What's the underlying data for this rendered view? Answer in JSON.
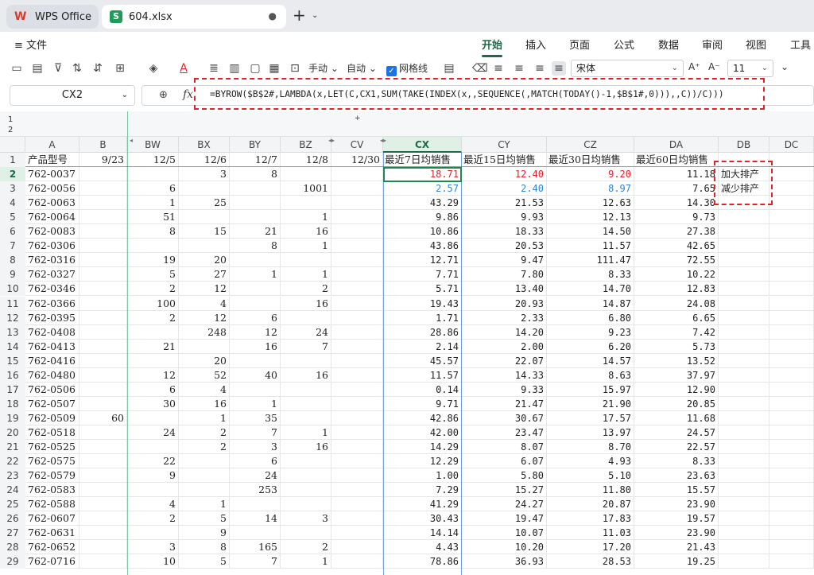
{
  "tabs": {
    "home_label": "WPS Office",
    "home_logo": "W",
    "file_label": "604.xlsx",
    "file_logo": "S",
    "dot": "●",
    "new_tab": "+",
    "menu": "⌄"
  },
  "menu": {
    "file_label": "≡ 文件",
    "items": [
      "开始",
      "插入",
      "页面",
      "公式",
      "数据",
      "审阅",
      "视图",
      "工具"
    ]
  },
  "toolbar": {
    "manual_label": "手动",
    "auto_label": "自动",
    "gridlines_label": "网格线",
    "font_name": "宋体",
    "font_size": "11",
    "font_grow": "A⁺",
    "font_shrink": "A⁻",
    "more": "⌄"
  },
  "formula_bar": {
    "cell_ref": "CX2",
    "formula": "=BYROW($B$2#,LAMBDA(x,LET(C,CX1,SUM(TAKE(INDEX(x,,SEQUENCE(,MATCH(TODAY()-1,$B$1#,0))),,C))/C)))"
  },
  "outline": {
    "levels": [
      "1",
      "2"
    ],
    "plus": "+"
  },
  "columns": [
    "A",
    "B",
    "BW",
    "BX",
    "BY",
    "BZ",
    "CV",
    "CX",
    "CY",
    "CZ",
    "DA",
    "DB",
    "DC"
  ],
  "header_row": {
    "A": "产品型号",
    "B": "9/23",
    "BW": "12/5",
    "BX": "12/6",
    "BY": "12/7",
    "BZ": "12/8",
    "CV": "12/30",
    "CX": "最近7日均销售",
    "CY": "最近15日均销售",
    "CZ": "最近30日均销售",
    "DA": "最近60日均销售"
  },
  "legend_cells": [
    "加大排产",
    "减少排产"
  ],
  "rows": [
    {
      "n": "2",
      "A": "762-0037",
      "B": "",
      "BW": "",
      "BX": "3",
      "BY": "8",
      "BZ": "",
      "CX": "18.71",
      "CY": "12.40",
      "CZ": "9.20",
      "DA": "11.18"
    },
    {
      "n": "3",
      "A": "762-0056",
      "B": "",
      "BW": "6",
      "BX": "",
      "BY": "",
      "BZ": "1001",
      "CX": "2.57",
      "CY": "2.40",
      "CZ": "8.97",
      "DA": "7.65"
    },
    {
      "n": "4",
      "A": "762-0063",
      "B": "",
      "BW": "1",
      "BX": "25",
      "BY": "",
      "BZ": "",
      "CX": "43.29",
      "CY": "21.53",
      "CZ": "12.63",
      "DA": "14.30"
    },
    {
      "n": "5",
      "A": "762-0064",
      "B": "",
      "BW": "51",
      "BX": "",
      "BY": "",
      "BZ": "1",
      "CX": "9.86",
      "CY": "9.93",
      "CZ": "12.13",
      "DA": "9.73"
    },
    {
      "n": "6",
      "A": "762-0083",
      "B": "",
      "BW": "8",
      "BX": "15",
      "BY": "21",
      "BZ": "16",
      "CX": "10.86",
      "CY": "18.33",
      "CZ": "14.50",
      "DA": "27.38"
    },
    {
      "n": "7",
      "A": "762-0306",
      "B": "",
      "BW": "",
      "BX": "",
      "BY": "8",
      "BZ": "1",
      "CX": "43.86",
      "CY": "20.53",
      "CZ": "11.57",
      "DA": "42.65"
    },
    {
      "n": "8",
      "A": "762-0316",
      "B": "",
      "BW": "19",
      "BX": "20",
      "BY": "",
      "BZ": "",
      "CX": "12.71",
      "CY": "9.47",
      "CZ": "111.47",
      "DA": "72.55"
    },
    {
      "n": "9",
      "A": "762-0327",
      "B": "",
      "BW": "5",
      "BX": "27",
      "BY": "1",
      "BZ": "1",
      "CX": "7.71",
      "CY": "7.80",
      "CZ": "8.33",
      "DA": "10.22"
    },
    {
      "n": "10",
      "A": "762-0346",
      "B": "",
      "BW": "2",
      "BX": "12",
      "BY": "",
      "BZ": "2",
      "CX": "5.71",
      "CY": "13.40",
      "CZ": "14.70",
      "DA": "12.83"
    },
    {
      "n": "11",
      "A": "762-0366",
      "B": "",
      "BW": "100",
      "BX": "4",
      "BY": "",
      "BZ": "16",
      "CX": "19.43",
      "CY": "20.93",
      "CZ": "14.87",
      "DA": "24.08"
    },
    {
      "n": "12",
      "A": "762-0395",
      "B": "",
      "BW": "2",
      "BX": "12",
      "BY": "6",
      "BZ": "",
      "CX": "1.71",
      "CY": "2.33",
      "CZ": "6.80",
      "DA": "6.65"
    },
    {
      "n": "13",
      "A": "762-0408",
      "B": "",
      "BW": "",
      "BX": "248",
      "BY": "12",
      "BZ": "24",
      "CX": "28.86",
      "CY": "14.20",
      "CZ": "9.23",
      "DA": "7.42"
    },
    {
      "n": "14",
      "A": "762-0413",
      "B": "",
      "BW": "21",
      "BX": "",
      "BY": "16",
      "BZ": "7",
      "CX": "2.14",
      "CY": "2.00",
      "CZ": "6.20",
      "DA": "5.73"
    },
    {
      "n": "15",
      "A": "762-0416",
      "B": "",
      "BW": "",
      "BX": "20",
      "BY": "",
      "BZ": "",
      "CX": "45.57",
      "CY": "22.07",
      "CZ": "14.57",
      "DA": "13.52"
    },
    {
      "n": "16",
      "A": "762-0480",
      "B": "",
      "BW": "12",
      "BX": "52",
      "BY": "40",
      "BZ": "16",
      "CX": "11.57",
      "CY": "14.33",
      "CZ": "8.63",
      "DA": "37.97"
    },
    {
      "n": "17",
      "A": "762-0506",
      "B": "",
      "BW": "6",
      "BX": "4",
      "BY": "",
      "BZ": "",
      "CX": "0.14",
      "CY": "9.33",
      "CZ": "15.97",
      "DA": "12.90"
    },
    {
      "n": "18",
      "A": "762-0507",
      "B": "",
      "BW": "30",
      "BX": "16",
      "BY": "1",
      "BZ": "",
      "CX": "9.71",
      "CY": "21.47",
      "CZ": "21.90",
      "DA": "20.85"
    },
    {
      "n": "19",
      "A": "762-0509",
      "B": "60",
      "BW": "",
      "BX": "1",
      "BY": "35",
      "BZ": "",
      "CX": "42.86",
      "CY": "30.67",
      "CZ": "17.57",
      "DA": "11.68"
    },
    {
      "n": "20",
      "A": "762-0518",
      "B": "",
      "BW": "24",
      "BX": "2",
      "BY": "7",
      "BZ": "1",
      "CX": "42.00",
      "CY": "23.47",
      "CZ": "13.97",
      "DA": "24.57"
    },
    {
      "n": "21",
      "A": "762-0525",
      "B": "",
      "BW": "",
      "BX": "2",
      "BY": "3",
      "BZ": "16",
      "CX": "14.29",
      "CY": "8.07",
      "CZ": "8.70",
      "DA": "22.57"
    },
    {
      "n": "22",
      "A": "762-0575",
      "B": "",
      "BW": "22",
      "BX": "",
      "BY": "6",
      "BZ": "",
      "CX": "12.29",
      "CY": "6.07",
      "CZ": "4.93",
      "DA": "8.33"
    },
    {
      "n": "23",
      "A": "762-0579",
      "B": "",
      "BW": "9",
      "BX": "",
      "BY": "24",
      "BZ": "",
      "CX": "1.00",
      "CY": "5.80",
      "CZ": "5.10",
      "DA": "23.63"
    },
    {
      "n": "24",
      "A": "762-0583",
      "B": "",
      "BW": "",
      "BX": "",
      "BY": "253",
      "BZ": "",
      "CX": "7.29",
      "CY": "15.27",
      "CZ": "11.80",
      "DA": "15.57"
    },
    {
      "n": "25",
      "A": "762-0588",
      "B": "",
      "BW": "4",
      "BX": "1",
      "BY": "",
      "BZ": "",
      "CX": "41.29",
      "CY": "24.27",
      "CZ": "20.87",
      "DA": "23.90"
    },
    {
      "n": "26",
      "A": "762-0607",
      "B": "",
      "BW": "2",
      "BX": "5",
      "BY": "14",
      "BZ": "3",
      "CX": "30.43",
      "CY": "19.47",
      "CZ": "17.83",
      "DA": "19.57"
    },
    {
      "n": "27",
      "A": "762-0631",
      "B": "",
      "BW": "",
      "BX": "9",
      "BY": "",
      "BZ": "",
      "CX": "14.14",
      "CY": "10.07",
      "CZ": "11.03",
      "DA": "23.90"
    },
    {
      "n": "28",
      "A": "762-0652",
      "B": "",
      "BW": "3",
      "BX": "8",
      "BY": "165",
      "BZ": "2",
      "CX": "4.43",
      "CY": "10.20",
      "CZ": "17.20",
      "DA": "21.43"
    },
    {
      "n": "29",
      "A": "762-0716",
      "B": "",
      "BW": "10",
      "BX": "5",
      "BY": "7",
      "BZ": "1",
      "CX": "78.86",
      "CY": "36.93",
      "CZ": "28.53",
      "DA": "19.25"
    }
  ],
  "colors": {
    "accent": "#1c6b48",
    "increase": "#e0232a",
    "decrease": "#2f86d6",
    "annotation": "#e0232a"
  },
  "cell_colors": {
    "2": {
      "CX": "red",
      "CY": "red",
      "CZ": "red"
    },
    "3": {
      "CX": "blue",
      "CY": "blue",
      "CZ": "blue"
    }
  }
}
